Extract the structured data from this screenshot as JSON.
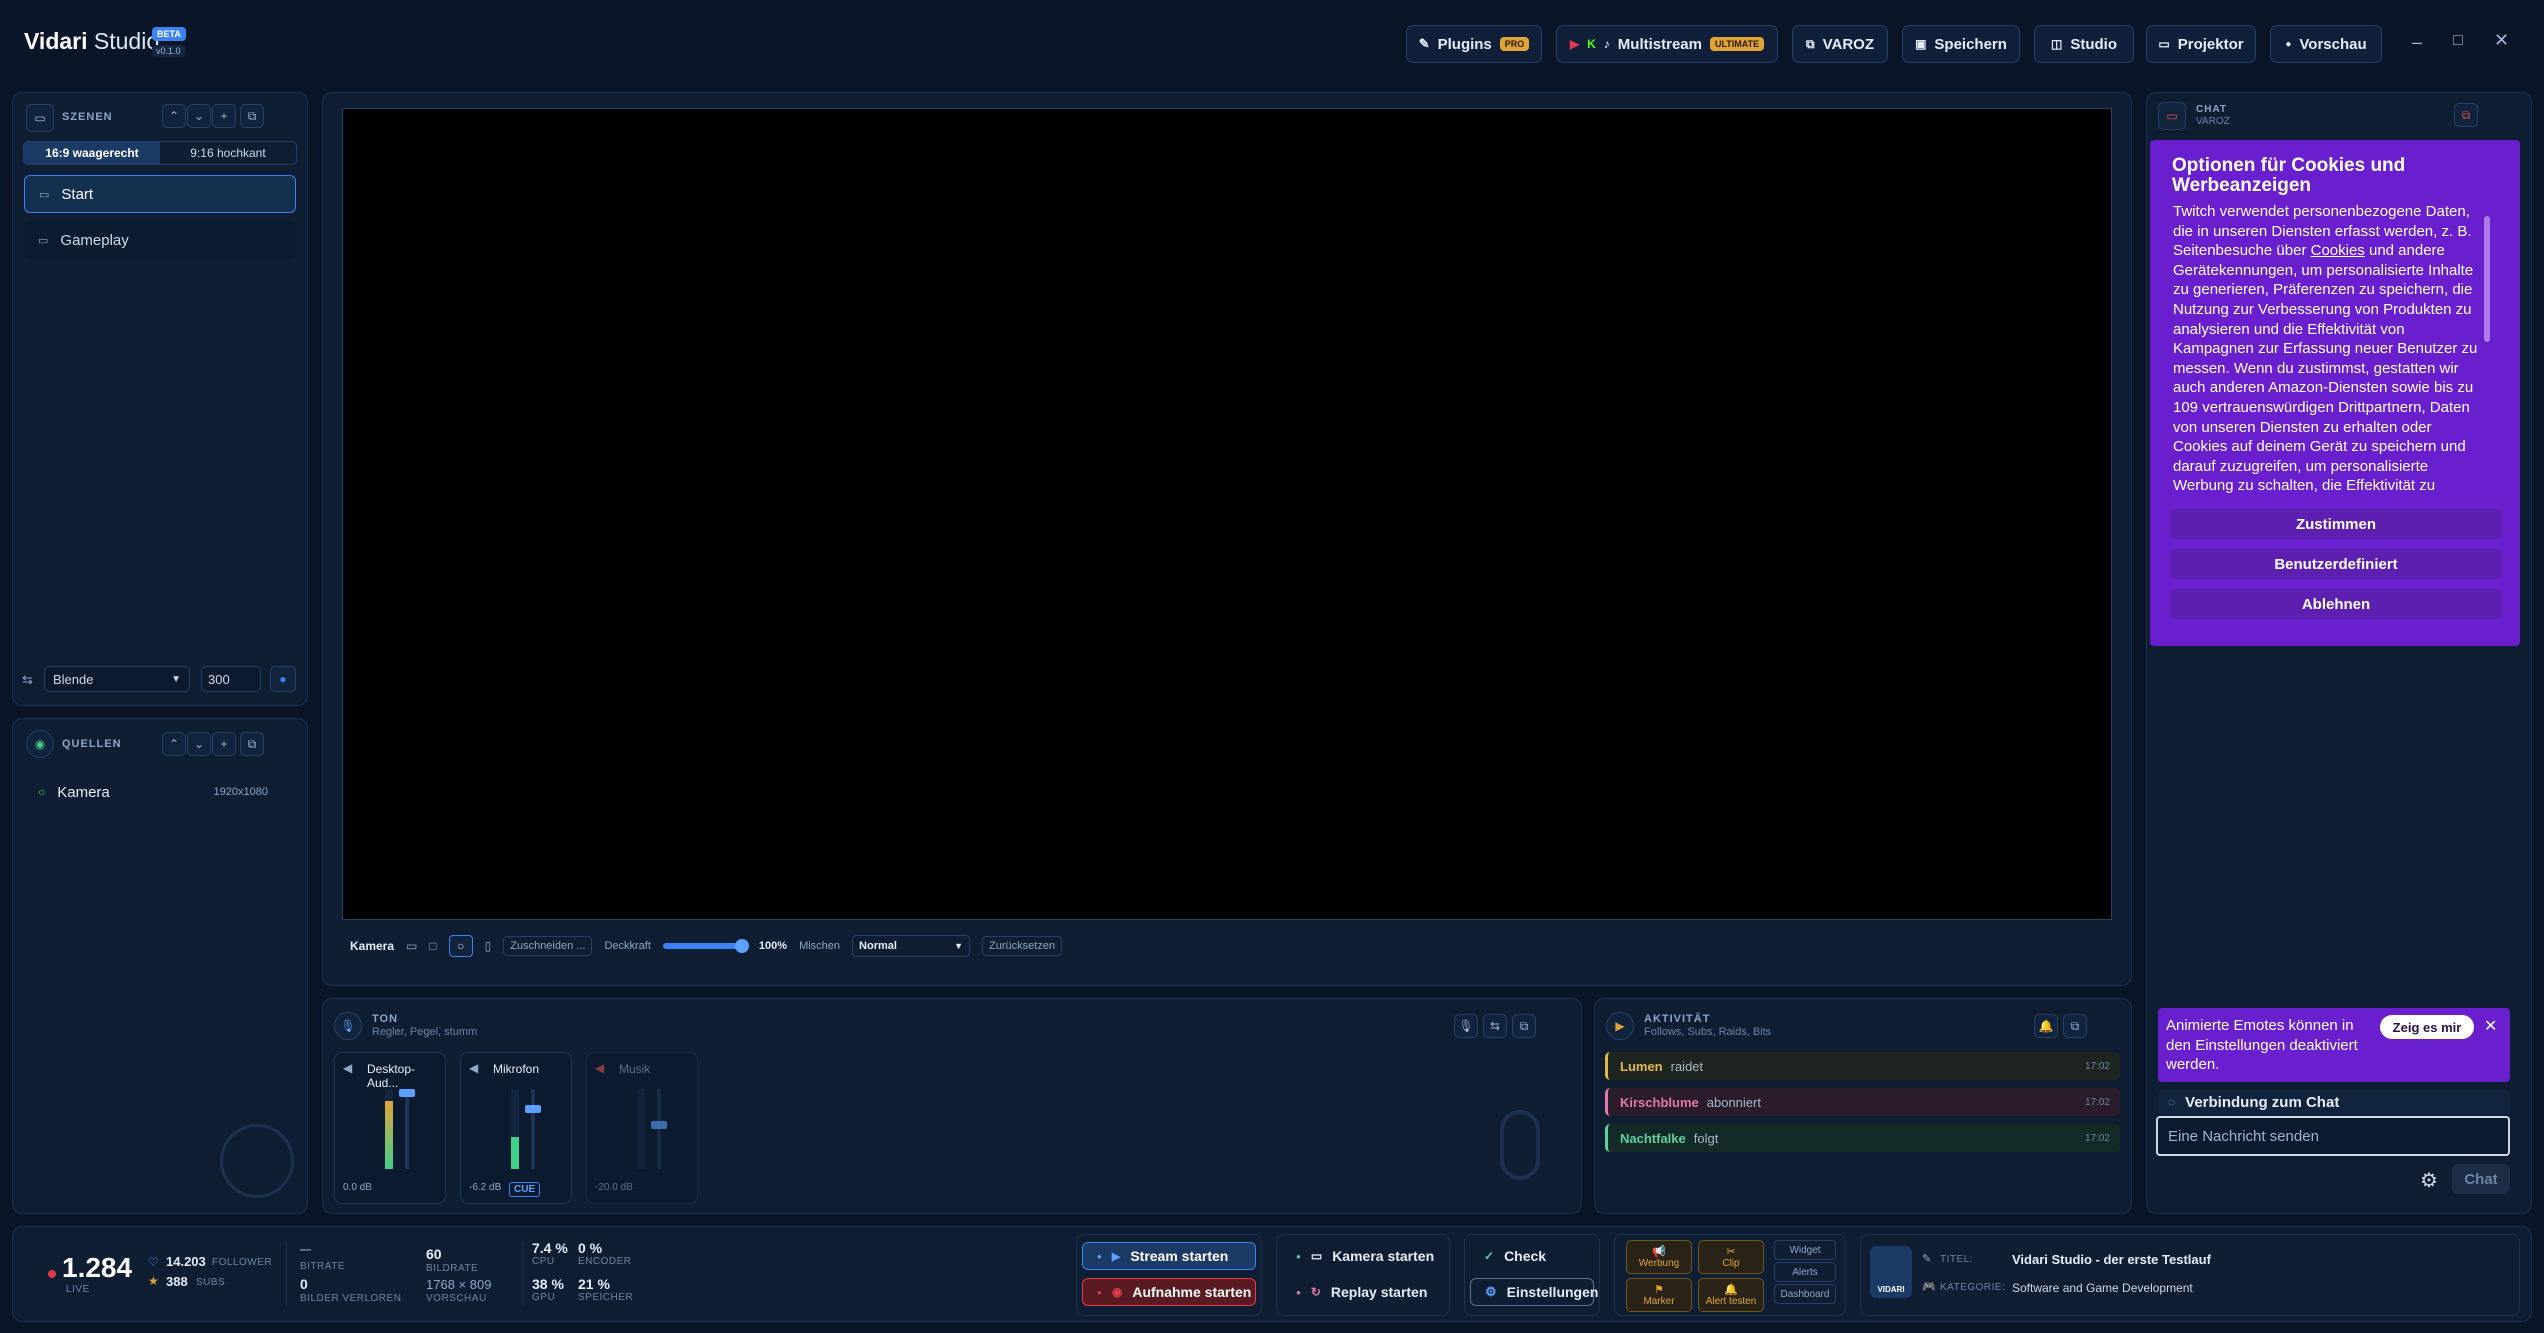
{
  "app": {
    "name_a": "Vidari",
    "name_b": "Studio",
    "badge": "BETA",
    "version": "v0.1.0"
  },
  "topbar": {
    "plugins": {
      "label": "Plugins",
      "badge": "PRO"
    },
    "multistream": {
      "label": "Multistream",
      "badge": "ULTIMATE"
    },
    "channel": "VAROZ",
    "save": "Speichern",
    "studio": "Studio",
    "projector": "Projektor",
    "preview": "Vorschau"
  },
  "scenes": {
    "title": "SZENEN",
    "formats": [
      "16:9 waagerecht",
      "9:16 hochkant"
    ],
    "items": [
      "Start",
      "Gameplay"
    ],
    "transition": "Blende",
    "duration": "300"
  },
  "sources": {
    "title": "QUELLEN",
    "items": [
      {
        "name": "Kamera",
        "res": "1920x1080"
      }
    ]
  },
  "preview_bar": {
    "source": "Kamera",
    "crop": "Zuschneiden ...",
    "opacity_label": "Deckkraft",
    "opacity": "100%",
    "opacity_value": 1.0,
    "blend_label": "Mischen",
    "blend": "Normal",
    "reset": "Zurücksetzen"
  },
  "audio": {
    "title": "TON",
    "subtitle": "Regler, Pegel, stumm",
    "channels": [
      {
        "name": "Desktop-Aud...",
        "db": "0.0 dB",
        "level": 0.85
      },
      {
        "name": "Mikrofon",
        "db": "-6.2 dB",
        "level": 0.4,
        "cue": "CUE"
      },
      {
        "name": "Musik",
        "db": "-20.0 dB",
        "level": 0.0
      }
    ]
  },
  "activity": {
    "title": "AKTIVITÄT",
    "subtitle": "Follows, Subs, Raids, Bits",
    "items": [
      {
        "user": "Lumen",
        "action": "raidet",
        "time": "17:02",
        "color": "#e6b84a"
      },
      {
        "user": "Kirschblume",
        "action": "abonniert",
        "time": "17:02",
        "color": "#e07aa8"
      },
      {
        "user": "Nachtfalke",
        "action": "folgt",
        "time": "17:02",
        "color": "#5fd0a0"
      }
    ]
  },
  "chat": {
    "title": "CHAT",
    "channel": "VAROZ",
    "cookie": {
      "heading": "Optionen für Cookies und Werbeanzeigen",
      "body_1": "Twitch verwendet personenbezogene Daten, die in unseren Diensten erfasst werden, z. B. Seitenbesuche über",
      "link": "Cookies",
      "body_2": "und andere Gerätekennungen, um personalisierte Inhalte zu generieren, Präferenzen zu speichern, die Nutzung zur Verbesserung von Produkten zu analysieren und die Effektivität von Kampagnen zur Erfassung neuer Benutzer zu messen. Wenn du zustimmst, gestatten wir auch anderen Amazon-Diensten sowie bis zu 109 vertrauenswürdigen Drittpartnern, Daten von unseren Diensten zu erhalten oder Cookies auf deinem Gerät zu speichern und darauf zuzugreifen, um personalisierte Werbung zu schalten, die Effektivität zu",
      "accept": "Zustimmen",
      "custom": "Benutzerdefiniert",
      "decline": "Ablehnen"
    },
    "emote_notice": "Animierte Emotes können in den Einstellungen deaktiviert werden.",
    "show_me": "Zeig es mir",
    "connecting": "Verbindung zum Chat",
    "input_placeholder": "Eine Nachricht senden",
    "send": "Chat"
  },
  "footer": {
    "viewers": "1.284",
    "live": "LIVE",
    "followers": "14.203",
    "followers_label": "FOLLOWER",
    "subs": "388",
    "subs_label": "SUBS",
    "bitrate": "—",
    "bitrate_label": "BITRATE",
    "dropped": "0",
    "dropped_label": "BILDER VERLOREN",
    "fps": "60",
    "fps_label": "BILDRATE",
    "res": "1768 × 809",
    "res_label": "VORSCHAU",
    "cpu": "7.4 %",
    "cpu_label": "CPU",
    "encoder": "0 %",
    "encoder_label": "ENCODER",
    "gpu": "38 %",
    "gpu_label": "GPU",
    "mem": "21 %",
    "mem_label": "SPEICHER",
    "stream": "Stream starten",
    "record": "Aufnahme starten",
    "camera": "Kamera starten",
    "replay": "Replay starten",
    "check": "Check",
    "settings": "Einstellungen",
    "ad": "Werbung",
    "clip": "Clip",
    "marker": "Marker",
    "alert_test": "Alert testen",
    "widget": "Widget",
    "alerts": "Alerts",
    "dashboard": "Dashboard",
    "title_label": "TITEL:",
    "title": "Vidari Studio - der erste Testlauf",
    "category_label": "KATEGORIE:",
    "category": "Software and Game Development",
    "logo_text": "VIDARI"
  },
  "colors": {
    "accent": "#3b82f6",
    "purple": "#6a1fcf",
    "bg": "#0a1628",
    "red": "#e23b4a"
  }
}
